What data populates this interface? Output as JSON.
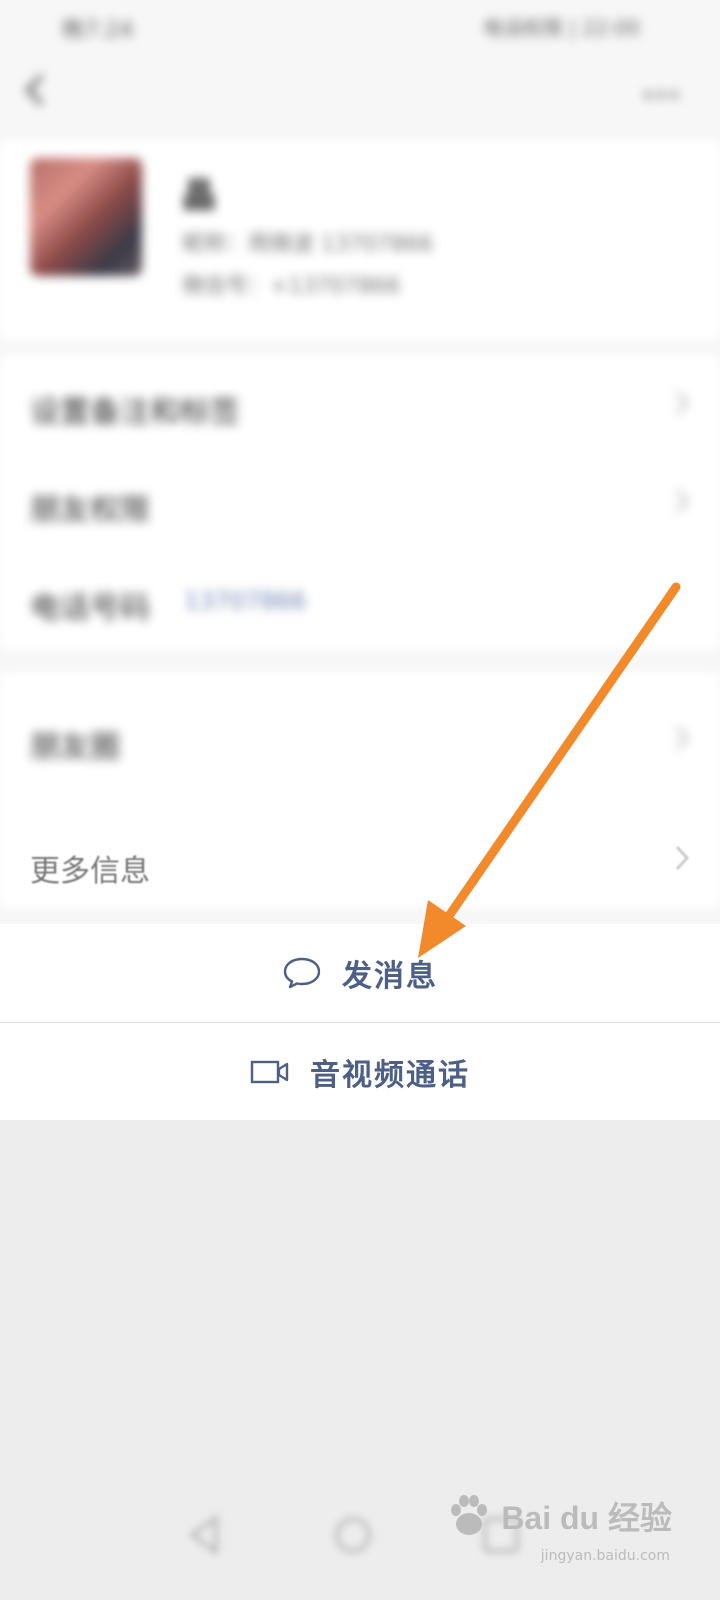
{
  "status_bar": {
    "time": "晚7:24",
    "right": "电话权限 | 22:00"
  },
  "profile": {
    "name": "晶",
    "line1": "昵称：雨微波 13707866",
    "line2": "微信号：+13707866"
  },
  "rows": [
    {
      "label": "设置备注和标签"
    },
    {
      "label": "朋友权限"
    },
    {
      "label": "电话号码",
      "value": "13707866"
    },
    {
      "label": "朋友圈"
    },
    {
      "label": "更多信息"
    }
  ],
  "actions": {
    "send_message": "发消息",
    "av_call": "音视频通话"
  },
  "icons": {
    "back": "back-arrow-icon",
    "more": "more-dots-icon",
    "chevron": "chevron-right-icon",
    "message": "speech-bubble-icon",
    "video": "video-camera-icon"
  },
  "colors": {
    "action_text": "#4d5f86",
    "annotation_arrow": "#f2892b",
    "link_value": "#6f84b3",
    "page_bg": "#ededed"
  },
  "watermark": {
    "brand": "Bai du 经验",
    "url": "jingyan.baidu.com"
  }
}
